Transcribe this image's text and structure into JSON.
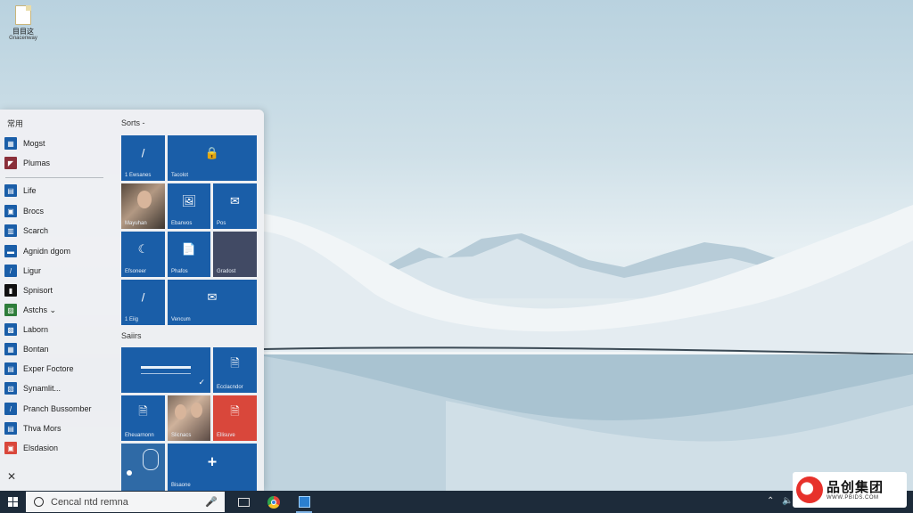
{
  "desktop": {
    "icon_name": "目目这",
    "icon_sub": "Gnacenway"
  },
  "start_menu": {
    "list_header": "常用",
    "pinned_apps": [
      {
        "label": "Mogst",
        "icon": "app-icon"
      },
      {
        "label": "Plumas",
        "icon": "app-icon"
      }
    ],
    "apps": [
      {
        "label": "Life",
        "icon": "app-icon"
      },
      {
        "label": "Brocs",
        "icon": "app-icon"
      },
      {
        "label": "Scarch",
        "icon": "app-icon"
      },
      {
        "label": "Agnidn dgom",
        "icon": "app-icon"
      },
      {
        "label": "Ligur",
        "icon": "app-icon"
      },
      {
        "label": "Spnisort",
        "icon": "app-icon"
      },
      {
        "label": "Astchs ⌄",
        "icon": "app-icon"
      },
      {
        "label": "Laborn",
        "icon": "app-icon"
      },
      {
        "label": "Bontan",
        "icon": "app-icon"
      },
      {
        "label": "Exper Foctore",
        "icon": "app-icon"
      },
      {
        "label": "Synamlit...",
        "icon": "app-icon"
      },
      {
        "label": "Pranch Bussomber",
        "icon": "app-icon"
      },
      {
        "label": "Thva Mors",
        "icon": "app-icon"
      },
      {
        "label": "Elsdasion",
        "icon": "app-icon"
      }
    ],
    "close_glyph": "✕",
    "sections": [
      {
        "title": "Sorts -"
      },
      {
        "title": "Saiirs"
      }
    ],
    "tiles": {
      "t1": {
        "label": "1 Ewsanes",
        "glyph": "/"
      },
      "t2": {
        "label": "Tacolot",
        "glyph": "🔒"
      },
      "t3": {
        "label": "Mayuhan",
        "glyph": ""
      },
      "t4": {
        "label": "Ebanvos",
        "glyph": "🖼"
      },
      "t5": {
        "label": "Pos",
        "glyph": "✉"
      },
      "t6": {
        "label": "Efsoneer",
        "glyph": "☾"
      },
      "t7": {
        "label": "Phafos",
        "glyph": "📄"
      },
      "t8": {
        "label": "Gradost",
        "glyph": ""
      },
      "t9": {
        "label": "1 Eiig",
        "glyph": "/"
      },
      "t10": {
        "label": "Vencum",
        "glyph": "✉"
      },
      "t11": {
        "label": "",
        "glyph": ""
      },
      "t12": {
        "label": "Ecclacndor",
        "glyph": "🗎"
      },
      "t13": {
        "label": "Eheuarnonn",
        "glyph": "🗎"
      },
      "t14": {
        "label": "Slicnacs",
        "glyph": ""
      },
      "t15": {
        "label": "Ellisuve",
        "glyph": "🗎"
      },
      "t16": {
        "label": "",
        "glyph": ""
      },
      "t17": {
        "label": "Bisaone",
        "glyph": "+"
      }
    }
  },
  "taskbar": {
    "search_placeholder": "Cencal ntd remna",
    "mic_glyph": "🎤",
    "tray_chevron": "⌃",
    "tray_speaker": "🔈"
  },
  "watermark": {
    "brand": "品创集团",
    "url": "WWW.PBIDS.COM"
  }
}
